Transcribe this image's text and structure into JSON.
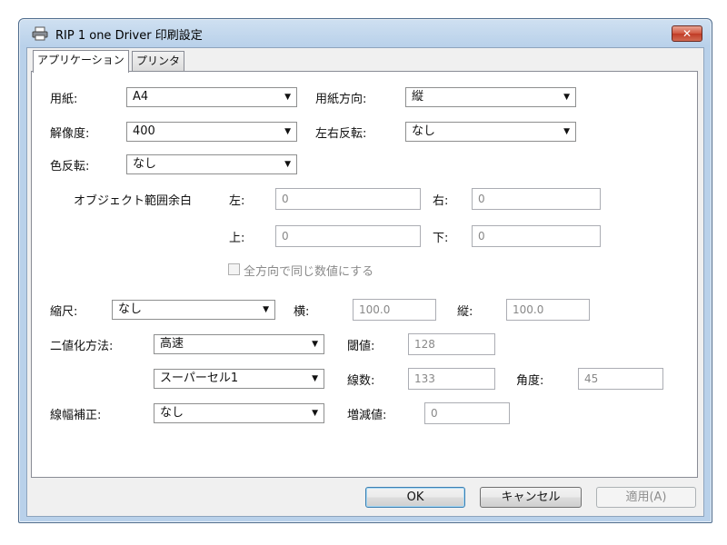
{
  "window": {
    "title": "RIP 1 one Driver 印刷設定",
    "close_label": "✕"
  },
  "tabs": [
    {
      "label": "アプリケーション",
      "active": true
    },
    {
      "label": "プリンタ",
      "active": false
    }
  ],
  "fields": {
    "paper": {
      "label": "用紙:",
      "value": "A4"
    },
    "orientation": {
      "label": "用紙方向:",
      "value": "縦"
    },
    "resolution": {
      "label": "解像度:",
      "value": "400"
    },
    "mirror": {
      "label": "左右反転:",
      "value": "なし"
    },
    "invert": {
      "label": "色反転:",
      "value": "なし"
    }
  },
  "margins": {
    "title": "オブジェクト範囲余白",
    "left": {
      "label": "左:",
      "value": "0"
    },
    "right": {
      "label": "右:",
      "value": "0"
    },
    "top": {
      "label": "上:",
      "value": "0"
    },
    "bottom": {
      "label": "下:",
      "value": "0"
    },
    "same_all": {
      "label": "全方向で同じ数値にする",
      "checked": false
    }
  },
  "scale": {
    "label": "縮尺:",
    "value": "なし",
    "horizontal": {
      "label": "横:",
      "value": "100.0"
    },
    "vertical": {
      "label": "縦:",
      "value": "100.0"
    }
  },
  "binarize": {
    "label": "二値化方法:",
    "method": "高速",
    "threshold": {
      "label": "閾値:",
      "value": "128"
    },
    "screen": "スーパーセル1",
    "lines": {
      "label": "線数:",
      "value": "133"
    },
    "angle": {
      "label": "角度:",
      "value": "45"
    }
  },
  "linewidth": {
    "label": "線幅補正:",
    "value": "なし",
    "delta": {
      "label": "増減値:",
      "value": "0"
    }
  },
  "buttons": {
    "ok": "OK",
    "cancel": "キャンセル",
    "apply": "適用(A)"
  },
  "icons": {
    "printer": "printer-icon",
    "dropdown": "chevron-down-icon"
  }
}
